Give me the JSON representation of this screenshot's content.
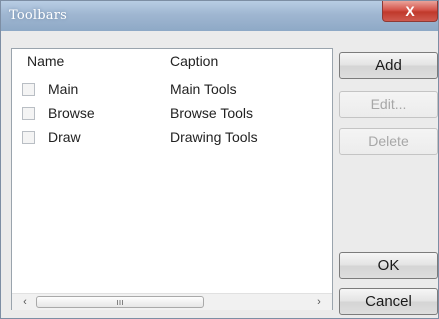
{
  "window": {
    "title": "Toolbars",
    "close_glyph": "X"
  },
  "list": {
    "columns": {
      "name": "Name",
      "caption": "Caption"
    },
    "rows": [
      {
        "name": "Main",
        "caption": "Main Tools",
        "checked": false
      },
      {
        "name": "Browse",
        "caption": "Browse Tools",
        "checked": false
      },
      {
        "name": "Draw",
        "caption": "Drawing Tools",
        "checked": false
      }
    ],
    "scrollbar": {
      "left_glyph": "‹",
      "right_glyph": "›",
      "thumb_grip": "ııı"
    }
  },
  "buttons": {
    "add": "Add",
    "edit": "Edit...",
    "delete": "Delete",
    "ok": "OK",
    "cancel": "Cancel"
  }
}
